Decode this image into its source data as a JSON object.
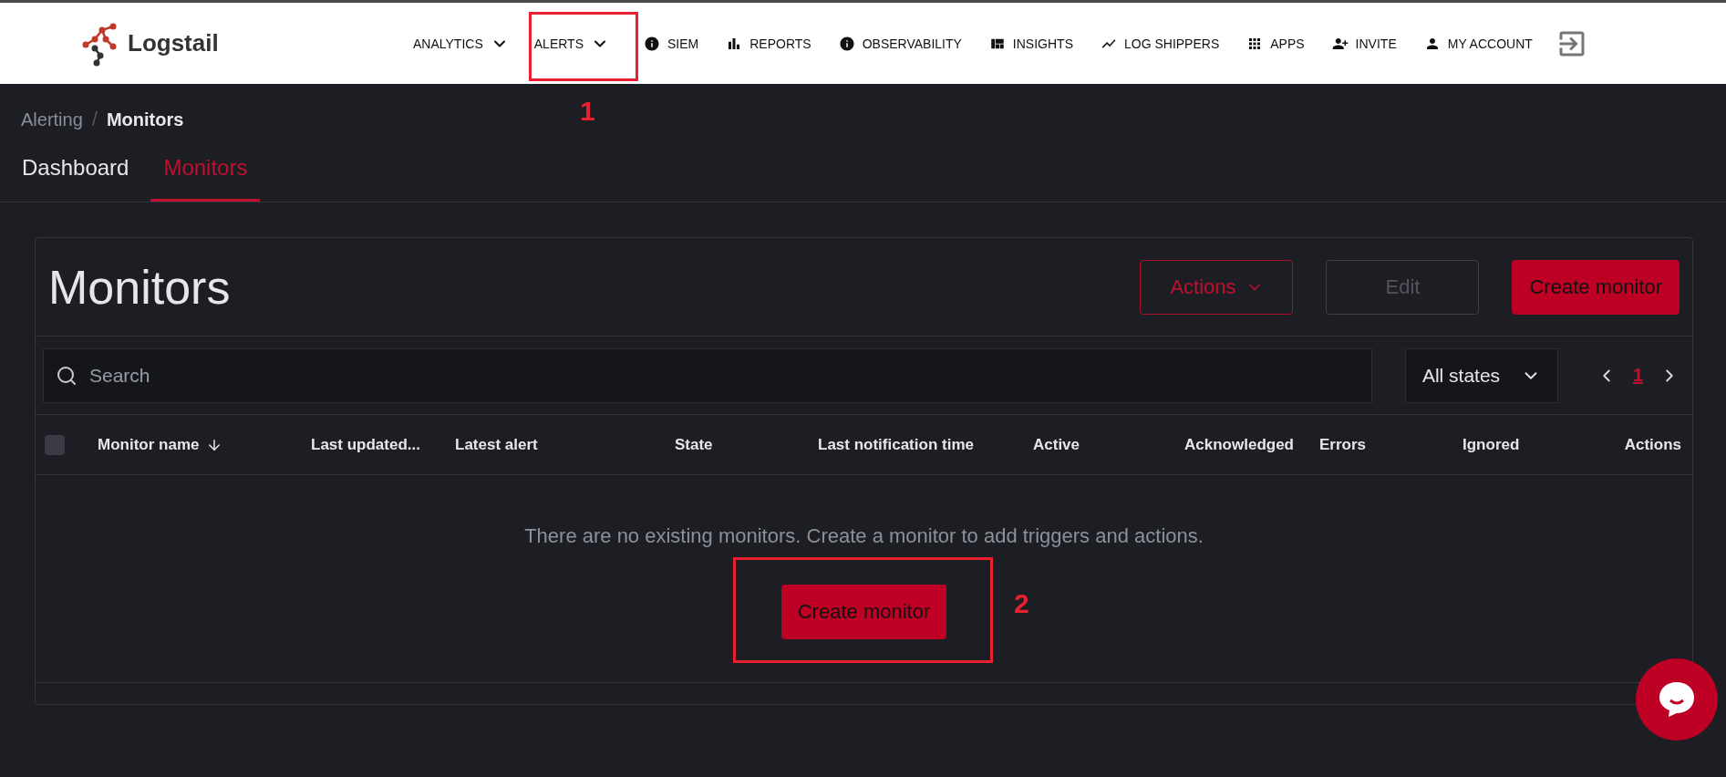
{
  "header": {
    "logo": "Logstail",
    "nav": [
      {
        "label": "ANALYTICS",
        "kind": "dropdown"
      },
      {
        "label": "ALERTS",
        "kind": "dropdown"
      },
      {
        "label": "SIEM",
        "kind": "link"
      },
      {
        "label": "REPORTS",
        "kind": "link"
      },
      {
        "label": "OBSERVABILITY",
        "kind": "link"
      },
      {
        "label": "INSIGHTS",
        "kind": "link"
      },
      {
        "label": "LOG SHIPPERS",
        "kind": "link"
      },
      {
        "label": "APPS",
        "kind": "link"
      },
      {
        "label": "INVITE",
        "kind": "link"
      },
      {
        "label": "MY ACCOUNT",
        "kind": "link"
      }
    ]
  },
  "breadcrumb_separator": "/",
  "breadcrumbs": [
    {
      "label": "Alerting",
      "selected": false
    },
    {
      "label": "Monitors",
      "selected": true
    }
  ],
  "tabs": [
    {
      "label": "Dashboard",
      "selected": false
    },
    {
      "label": "Monitors",
      "selected": true
    }
  ],
  "panel": {
    "title": "Monitors",
    "buttons": [
      {
        "label": "Actions",
        "kind": "outline",
        "disabled": false
      },
      {
        "label": "Edit",
        "kind": "outline",
        "disabled": true
      },
      {
        "label": "Create monitor",
        "kind": "fill",
        "disabled": false
      }
    ],
    "search": {
      "placeholder": "Search"
    },
    "state_filter": {
      "value": "All states"
    },
    "pagination": [
      {
        "label": "1",
        "selected": true
      }
    ],
    "table": {
      "select_all_checked": false,
      "columns": [
        "Monitor name",
        "Last updated...",
        "Latest alert",
        "State",
        "Last notification time",
        "Active",
        "Acknowledged",
        "Errors",
        "Ignored",
        "Actions"
      ],
      "empty_message": "There are no existing monitors. Create a monitor to add triggers and actions.",
      "empty_button": "Create monitor"
    }
  },
  "annotations": [
    {
      "label": "1"
    },
    {
      "label": "2"
    }
  ]
}
